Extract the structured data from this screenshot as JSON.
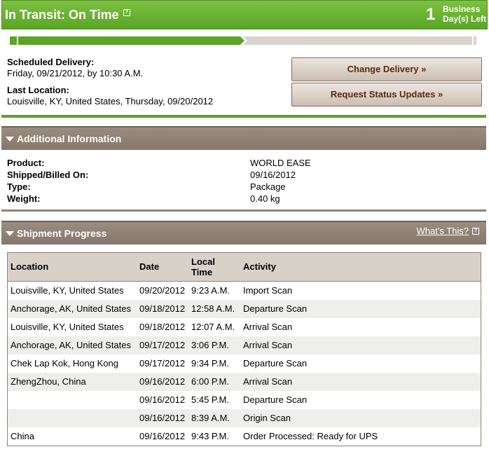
{
  "status": {
    "title": "In Transit: On Time",
    "help_glyph": "?",
    "days_left_count": "1",
    "days_left_label_line1": "Business",
    "days_left_label_line2": "Day(s) Left",
    "progress_fraction": 0.5
  },
  "delivery": {
    "scheduled_label": "Scheduled Delivery:",
    "scheduled_value": "Friday, 09/21/2012, by 10:30 A.M.",
    "last_location_label": "Last Location:",
    "last_location_value": "Louisville, KY, United States, Thursday, 09/20/2012",
    "change_delivery_label": "Change Delivery »",
    "request_updates_label": "Request Status Updates »"
  },
  "additional_info": {
    "title": "Additional Information",
    "rows": [
      {
        "label": "Product:",
        "value": "WORLD EASE"
      },
      {
        "label": "Shipped/Billed On:",
        "value": "09/16/2012"
      },
      {
        "label": "Type:",
        "value": "Package"
      },
      {
        "label": "Weight:",
        "value": "0.40 kg"
      }
    ]
  },
  "shipment_progress": {
    "title": "Shipment Progress",
    "whats_this": "What's This?",
    "columns": {
      "location": "Location",
      "date": "Date",
      "local_time_line1": "Local",
      "local_time_line2": "Time",
      "activity": "Activity"
    },
    "rows": [
      {
        "location": "Louisville, KY, United States",
        "date": "09/20/2012",
        "time": "9:23 A.M.",
        "activity": "Import Scan"
      },
      {
        "location": "Anchorage, AK, United States",
        "date": "09/18/2012",
        "time": "12:58 A.M.",
        "activity": "Departure Scan"
      },
      {
        "location": "Louisville, KY, United States",
        "date": "09/18/2012",
        "time": "12:07 A.M.",
        "activity": "Arrival Scan"
      },
      {
        "location": "Anchorage, AK, United States",
        "date": "09/17/2012",
        "time": "3:06 P.M.",
        "activity": "Arrival Scan"
      },
      {
        "location": "Chek Lap Kok, Hong Kong",
        "date": "09/17/2012",
        "time": "9:34 P.M.",
        "activity": "Departure Scan"
      },
      {
        "location": "ZhengZhou, China",
        "date": "09/16/2012",
        "time": "6:00 P.M.",
        "activity": "Arrival Scan"
      },
      {
        "location": "",
        "date": "09/16/2012",
        "time": "5:45 P.M.",
        "activity": "Departure Scan"
      },
      {
        "location": "",
        "date": "09/16/2012",
        "time": "8:39 A.M.",
        "activity": "Origin Scan"
      },
      {
        "location": "China",
        "date": "09/16/2012",
        "time": "9:43 P.M.",
        "activity": "Order Processed: Ready for UPS"
      }
    ]
  }
}
